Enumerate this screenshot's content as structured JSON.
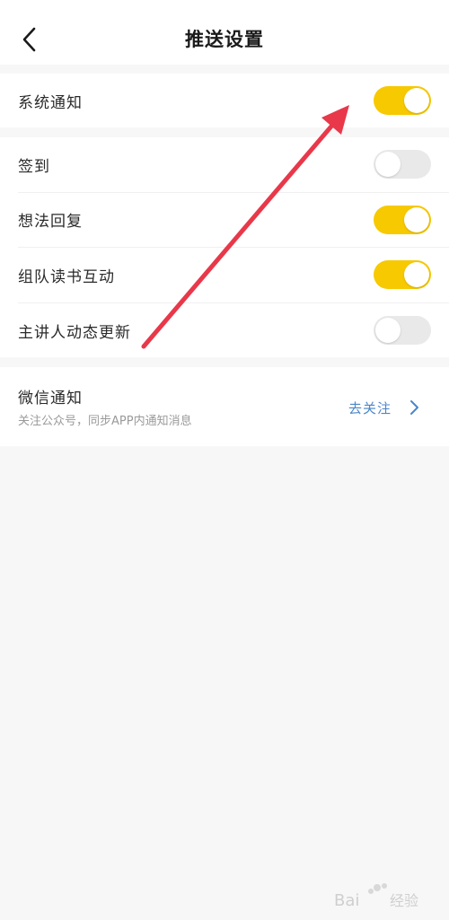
{
  "header": {
    "title": "推送设置",
    "back_icon": "chevron-left-icon"
  },
  "system_group": {
    "items": [
      {
        "label": "系统通知",
        "enabled": true
      }
    ]
  },
  "push_group": {
    "items": [
      {
        "label": "签到",
        "enabled": false
      },
      {
        "label": "想法回复",
        "enabled": true
      },
      {
        "label": "组队读书互动",
        "enabled": true
      },
      {
        "label": "主讲人动态更新",
        "enabled": false
      }
    ]
  },
  "wechat": {
    "title": "微信通知",
    "subtitle": "关注公众号，同步APP内通知消息",
    "action_label": "去关注",
    "action_icon": "chevron-right-icon"
  },
  "colors": {
    "toggle_on": "#f7c900",
    "toggle_off": "#e9e9e9",
    "link": "#4a86c8",
    "annotation_arrow": "#e8384a",
    "background": "#f7f7f7"
  }
}
